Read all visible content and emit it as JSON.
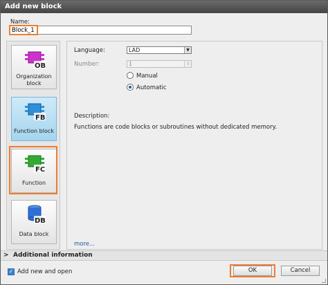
{
  "dialog": {
    "title": "Add new block"
  },
  "name": {
    "label": "Name:",
    "value": "Block_1"
  },
  "blocks": [
    {
      "badge": "OB",
      "label_line1": "Organization",
      "label_line2": "block",
      "color": "#cc33cc"
    },
    {
      "badge": "FB",
      "label_line1": "Function block",
      "color": "#2f8fd8"
    },
    {
      "badge": "FC",
      "label_line1": "Function",
      "color": "#33aa33"
    },
    {
      "badge": "DB",
      "label_line1": "Data block",
      "color": "#2f6fd8"
    }
  ],
  "form": {
    "language_label": "Language:",
    "language_value": "LAD",
    "number_label": "Number:",
    "number_value": "1",
    "manual_label": "Manual",
    "automatic_label": "Automatic",
    "selected_numbering": "Automatic"
  },
  "description": {
    "label": "Description:",
    "text": "Functions are code blocks or subroutines without dedicated memory."
  },
  "more_link": "more...",
  "additional_info": {
    "label": "Additional information"
  },
  "footer": {
    "add_new_and_open_label": "Add new and open",
    "add_new_and_open_checked": true,
    "ok_label": "OK",
    "cancel_label": "Cancel"
  },
  "colors": {
    "highlight": "#ee7d2d",
    "titlebar": "#4f4f4f",
    "selected_tile": "#b4dcf2"
  }
}
